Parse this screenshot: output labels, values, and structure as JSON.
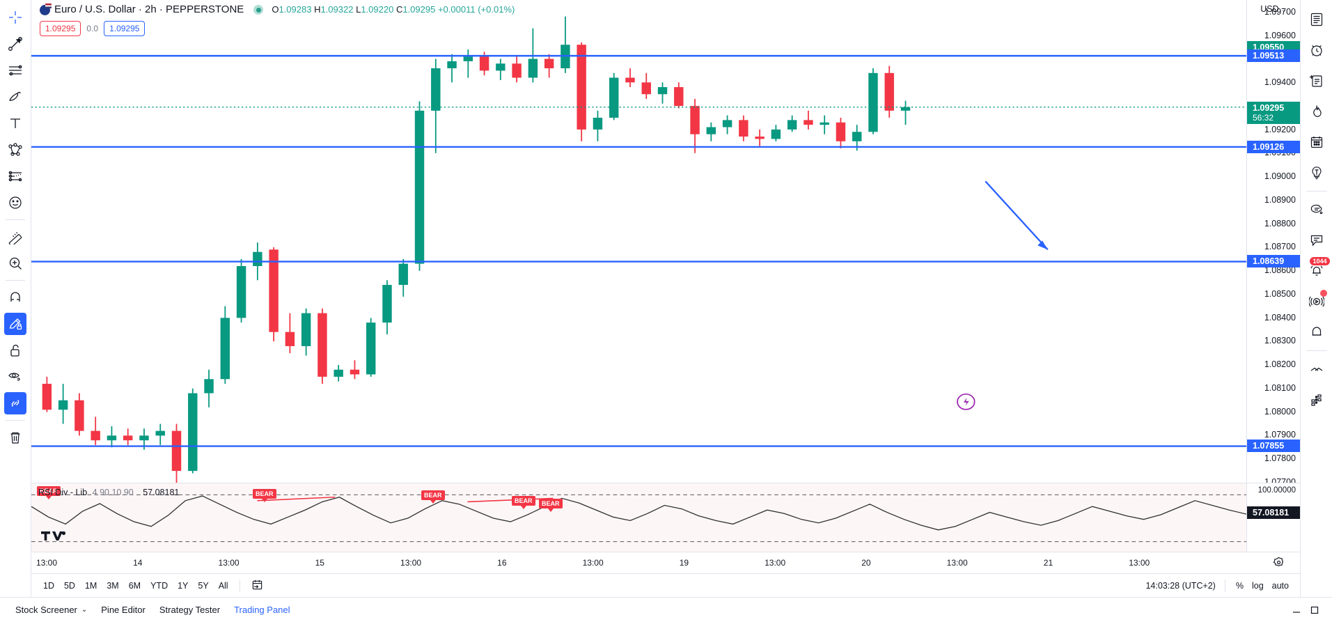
{
  "symbol": {
    "name": "Euro / U.S. Dollar",
    "interval": "2h",
    "exchange": "PEPPERSTONE",
    "title": "Euro / U.S. Dollar · 2h · PEPPERSTONE",
    "market_status": "market-open-dot"
  },
  "ohlc": {
    "o_label": "O",
    "o": "1.09283",
    "h_label": "H",
    "h": "1.09322",
    "l_label": "L",
    "l": "1.09220",
    "c_label": "C",
    "c": "1.09295",
    "change": "+0.00011",
    "change_pct": "(+0.01%)"
  },
  "legend_row2": {
    "sell_price": "1.09295",
    "spread": "0.0",
    "buy_price": "1.09295"
  },
  "price_scale": {
    "currency": "USD",
    "ticks": [
      "1.09700",
      "1.09600",
      "1.09400",
      "1.09200",
      "1.09100",
      "1.09000",
      "1.08900",
      "1.08800",
      "1.08700",
      "1.08600",
      "1.08500",
      "1.08400",
      "1.08300",
      "1.08200",
      "1.08100",
      "1.08000",
      "1.07900",
      "1.07800",
      "1.07700"
    ],
    "badges": [
      {
        "value": "1.09550",
        "color": "green",
        "sub": ""
      },
      {
        "value": "1.09513",
        "color": "blue",
        "sub": ""
      },
      {
        "value": "1.09295",
        "color": "green",
        "sub": "56:32"
      },
      {
        "value": "1.09126",
        "color": "blue",
        "sub": ""
      },
      {
        "value": "1.08639",
        "color": "blue",
        "sub": ""
      },
      {
        "value": "1.07855",
        "color": "blue",
        "sub": ""
      }
    ]
  },
  "rsi": {
    "name": "RSI Div - Lib",
    "params": "4 90 10 90",
    "value": "57.08181",
    "scale_top": "100.00000",
    "value_badge": "57.08181",
    "markers": [
      {
        "label": "BEAR"
      },
      {
        "label": "BEAR"
      },
      {
        "label": "BEAR"
      },
      {
        "label": "BEAR"
      }
    ]
  },
  "time_axis": {
    "ticks": [
      "13:00",
      "14",
      "13:00",
      "15",
      "13:00",
      "16",
      "13:00",
      "19",
      "13:00",
      "20",
      "13:00",
      "21",
      "13:00"
    ]
  },
  "bottom_bar": {
    "timeframes": [
      "1D",
      "5D",
      "1M",
      "3M",
      "6M",
      "YTD",
      "1Y",
      "5Y",
      "All"
    ],
    "calendar_icon": "date-range-icon",
    "clock": "14:03:28 (UTC+2)",
    "scale_options": [
      "%",
      "log",
      "auto"
    ]
  },
  "footer": {
    "items": [
      {
        "label": "Stock Screener",
        "caret": true,
        "accent": false
      },
      {
        "label": "Pine Editor",
        "caret": false,
        "accent": false
      },
      {
        "label": "Strategy Tester",
        "caret": false,
        "accent": false
      },
      {
        "label": "Trading Panel",
        "caret": false,
        "accent": true
      }
    ],
    "minimize": "minimize-icon",
    "maximize": "maximize-icon"
  },
  "left_toolbar": {
    "items": [
      {
        "name": "cross-cursor-icon",
        "active": false
      },
      {
        "name": "trend-line-icon",
        "active": false
      },
      {
        "name": "horizontal-lines-icon",
        "active": false
      },
      {
        "name": "brush-icon",
        "active": false
      },
      {
        "name": "text-tool-icon",
        "active": false
      },
      {
        "name": "patterns-icon",
        "active": false
      },
      {
        "name": "prediction-tool-icon",
        "active": false
      },
      {
        "name": "emoji-icon",
        "active": false
      },
      {
        "name": "measure-ruler-icon",
        "active": false
      },
      {
        "name": "zoom-in-icon",
        "active": false
      },
      {
        "name": "magnet-icon",
        "active": false
      },
      {
        "name": "drawing-lock-icon",
        "active": true
      },
      {
        "name": "unlock-icon",
        "active": false
      },
      {
        "name": "hide-drawings-icon",
        "active": false
      },
      {
        "name": "sync-drawings-icon",
        "active": true
      },
      {
        "name": "remove-drawings-icon",
        "active": false
      }
    ]
  },
  "right_toolbar": {
    "items": [
      {
        "name": "watchlist-icon",
        "badge": ""
      },
      {
        "name": "alerts-clock-icon",
        "badge": ""
      },
      {
        "name": "data-window-icon",
        "badge": ""
      },
      {
        "name": "hotlist-fire-icon",
        "badge": ""
      },
      {
        "name": "calendar-icon",
        "badge": ""
      },
      {
        "name": "ideas-bulb-icon",
        "badge": ""
      },
      {
        "name": "chat-thought-icon",
        "badge": ""
      },
      {
        "name": "public-chats-icon",
        "badge": ""
      },
      {
        "name": "notifications-icon",
        "badge": "1044"
      },
      {
        "name": "broadcast-icon",
        "badge": "dot"
      },
      {
        "name": "alert-bell-icon",
        "badge": ""
      },
      {
        "name": "chevrons-icon",
        "badge": ""
      },
      {
        "name": "object-tree-icon",
        "badge": ""
      }
    ]
  },
  "chart_data": {
    "type": "candlestick",
    "title": "Euro / U.S. Dollar · 2h · PEPPERSTONE",
    "xlabel": "",
    "ylabel": "USD",
    "ylim": [
      1.077,
      1.0975
    ],
    "grid": false,
    "up_color": "#089981",
    "down_color": "#f23645",
    "horizontal_lines": [
      {
        "price": 1.09513,
        "color": "#2962ff",
        "label": "1.09513"
      },
      {
        "price": 1.09126,
        "color": "#2962ff",
        "label": "1.09126"
      },
      {
        "price": 1.08639,
        "color": "#2962ff",
        "label": "1.08639"
      },
      {
        "price": 1.07855,
        "color": "#2962ff",
        "label": "1.07855"
      }
    ],
    "arrow_annotation": {
      "color": "#2962ff",
      "from_price": 1.0898,
      "to_price": 1.0869,
      "direction": "down-right"
    },
    "candles": [
      {
        "o": 1.0812,
        "h": 1.0815,
        "l": 1.08,
        "c": 1.0801,
        "d": "13:00"
      },
      {
        "o": 1.0801,
        "h": 1.0812,
        "l": 1.0795,
        "c": 1.0805,
        "d": ""
      },
      {
        "o": 1.0805,
        "h": 1.0808,
        "l": 1.079,
        "c": 1.0792,
        "d": ""
      },
      {
        "o": 1.0792,
        "h": 1.0798,
        "l": 1.0786,
        "c": 1.0788,
        "d": ""
      },
      {
        "o": 1.0788,
        "h": 1.0794,
        "l": 1.0785,
        "c": 1.079,
        "d": "14"
      },
      {
        "o": 1.079,
        "h": 1.0793,
        "l": 1.0786,
        "c": 1.0788,
        "d": ""
      },
      {
        "o": 1.0788,
        "h": 1.0793,
        "l": 1.0784,
        "c": 1.079,
        "d": ""
      },
      {
        "o": 1.079,
        "h": 1.0795,
        "l": 1.0786,
        "c": 1.0792,
        "d": ""
      },
      {
        "o": 1.0792,
        "h": 1.0795,
        "l": 1.077,
        "c": 1.0775,
        "d": ""
      },
      {
        "o": 1.0775,
        "h": 1.081,
        "l": 1.0774,
        "c": 1.0808,
        "d": ""
      },
      {
        "o": 1.0808,
        "h": 1.0818,
        "l": 1.0802,
        "c": 1.0814,
        "d": ""
      },
      {
        "o": 1.0814,
        "h": 1.0845,
        "l": 1.0812,
        "c": 1.084,
        "d": ""
      },
      {
        "o": 1.084,
        "h": 1.0865,
        "l": 1.0838,
        "c": 1.0862,
        "d": "13:00"
      },
      {
        "o": 1.0862,
        "h": 1.0872,
        "l": 1.0856,
        "c": 1.0868,
        "d": ""
      },
      {
        "o": 1.0869,
        "h": 1.087,
        "l": 1.083,
        "c": 1.0834,
        "d": ""
      },
      {
        "o": 1.0834,
        "h": 1.0842,
        "l": 1.0825,
        "c": 1.0828,
        "d": ""
      },
      {
        "o": 1.0828,
        "h": 1.0844,
        "l": 1.0824,
        "c": 1.0842,
        "d": ""
      },
      {
        "o": 1.0842,
        "h": 1.0844,
        "l": 1.0812,
        "c": 1.0815,
        "d": ""
      },
      {
        "o": 1.0815,
        "h": 1.082,
        "l": 1.0813,
        "c": 1.0818,
        "d": "15"
      },
      {
        "o": 1.0818,
        "h": 1.0822,
        "l": 1.0814,
        "c": 1.0816,
        "d": ""
      },
      {
        "o": 1.0816,
        "h": 1.084,
        "l": 1.0815,
        "c": 1.0838,
        "d": ""
      },
      {
        "o": 1.0838,
        "h": 1.0856,
        "l": 1.0833,
        "c": 1.0854,
        "d": ""
      },
      {
        "o": 1.0854,
        "h": 1.0865,
        "l": 1.0849,
        "c": 1.0863,
        "d": ""
      },
      {
        "o": 1.0863,
        "h": 1.0932,
        "l": 1.086,
        "c": 1.0928,
        "d": "13:00"
      },
      {
        "o": 1.0928,
        "h": 1.095,
        "l": 1.091,
        "c": 1.0946,
        "d": ""
      },
      {
        "o": 1.0946,
        "h": 1.0952,
        "l": 1.094,
        "c": 1.0949,
        "d": ""
      },
      {
        "o": 1.0949,
        "h": 1.0954,
        "l": 1.0942,
        "c": 1.0951,
        "d": ""
      },
      {
        "o": 1.0951,
        "h": 1.0953,
        "l": 1.0943,
        "c": 1.0945,
        "d": ""
      },
      {
        "o": 1.0945,
        "h": 1.095,
        "l": 1.0941,
        "c": 1.0948,
        "d": ""
      },
      {
        "o": 1.0948,
        "h": 1.0951,
        "l": 1.094,
        "c": 1.0942,
        "d": "16"
      },
      {
        "o": 1.0942,
        "h": 1.0963,
        "l": 1.094,
        "c": 1.095,
        "d": ""
      },
      {
        "o": 1.095,
        "h": 1.0952,
        "l": 1.0942,
        "c": 1.0946,
        "d": ""
      },
      {
        "o": 1.0946,
        "h": 1.0968,
        "l": 1.0944,
        "c": 1.0956,
        "d": ""
      },
      {
        "o": 1.0956,
        "h": 1.0957,
        "l": 1.0915,
        "c": 1.092,
        "d": "13:00"
      },
      {
        "o": 1.092,
        "h": 1.0928,
        "l": 1.0915,
        "c": 1.0925,
        "d": ""
      },
      {
        "o": 1.0925,
        "h": 1.0944,
        "l": 1.0924,
        "c": 1.0942,
        "d": ""
      },
      {
        "o": 1.0942,
        "h": 1.0946,
        "l": 1.0938,
        "c": 1.094,
        "d": ""
      },
      {
        "o": 1.094,
        "h": 1.0944,
        "l": 1.0933,
        "c": 1.0935,
        "d": ""
      },
      {
        "o": 1.0935,
        "h": 1.094,
        "l": 1.0931,
        "c": 1.0938,
        "d": "19"
      },
      {
        "o": 1.0938,
        "h": 1.094,
        "l": 1.0929,
        "c": 1.093,
        "d": ""
      },
      {
        "o": 1.093,
        "h": 1.0933,
        "l": 1.091,
        "c": 1.0918,
        "d": ""
      },
      {
        "o": 1.0918,
        "h": 1.0923,
        "l": 1.0915,
        "c": 1.0921,
        "d": ""
      },
      {
        "o": 1.0921,
        "h": 1.0926,
        "l": 1.0918,
        "c": 1.0924,
        "d": "13:00"
      },
      {
        "o": 1.0924,
        "h": 1.0926,
        "l": 1.0915,
        "c": 1.0917,
        "d": ""
      },
      {
        "o": 1.0917,
        "h": 1.092,
        "l": 1.0913,
        "c": 1.0916,
        "d": ""
      },
      {
        "o": 1.0916,
        "h": 1.0922,
        "l": 1.0915,
        "c": 1.092,
        "d": ""
      },
      {
        "o": 1.092,
        "h": 1.0926,
        "l": 1.0919,
        "c": 1.0924,
        "d": ""
      },
      {
        "o": 1.0924,
        "h": 1.0928,
        "l": 1.092,
        "c": 1.0922,
        "d": ""
      },
      {
        "o": 1.0922,
        "h": 1.0926,
        "l": 1.0918,
        "c": 1.0923,
        "d": "20"
      },
      {
        "o": 1.0923,
        "h": 1.0925,
        "l": 1.0912,
        "c": 1.0915,
        "d": ""
      },
      {
        "o": 1.0915,
        "h": 1.0922,
        "l": 1.0911,
        "c": 1.0919,
        "d": ""
      },
      {
        "o": 1.0919,
        "h": 1.0946,
        "l": 1.0918,
        "c": 1.0944,
        "d": ""
      },
      {
        "o": 1.0944,
        "h": 1.0947,
        "l": 1.0925,
        "c": 1.0928,
        "d": ""
      },
      {
        "o": 1.0928,
        "h": 1.09322,
        "l": 1.0922,
        "c": 1.09295,
        "d": "13:00"
      }
    ],
    "rsi_series": {
      "name": "RSI Div - Lib",
      "params": "4 90 10 90",
      "last_value": 57.08181,
      "ylim": [
        0,
        100
      ],
      "upper_band": 90,
      "lower_band": 10,
      "divergence_markers": [
        "BEAR",
        "BEAR",
        "BEAR",
        "BEAR"
      ]
    }
  }
}
